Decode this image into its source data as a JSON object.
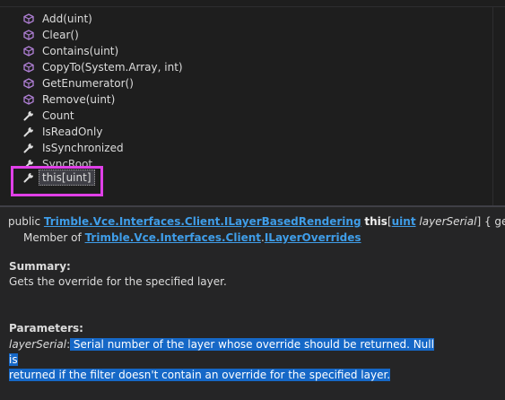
{
  "members": [
    {
      "label": "Add(uint)",
      "icon": "method-cube-icon"
    },
    {
      "label": "Clear()",
      "icon": "method-cube-icon"
    },
    {
      "label": "Contains(uint)",
      "icon": "method-cube-icon"
    },
    {
      "label": "CopyTo(System.Array, int)",
      "icon": "method-cube-icon"
    },
    {
      "label": "GetEnumerator()",
      "icon": "method-cube-icon"
    },
    {
      "label": "Remove(uint)",
      "icon": "method-cube-icon"
    },
    {
      "label": "Count",
      "icon": "property-wrench-icon"
    },
    {
      "label": "IsReadOnly",
      "icon": "property-wrench-icon"
    },
    {
      "label": "IsSynchronized",
      "icon": "property-wrench-icon"
    },
    {
      "label": "SyncRoot",
      "icon": "property-wrench-icon"
    },
    {
      "label": "this[uint]",
      "icon": "property-wrench-icon"
    }
  ],
  "tooltip": {
    "signature": {
      "prefix": "public ",
      "return_type": "Trimble.Vce.Interfaces.Client.ILayerBasedRendering",
      "space": " ",
      "name": "this",
      "open_bracket": "[",
      "param_type": "uint",
      "space2": " ",
      "param_name": "layerSerial",
      "suffix": "] { get; }"
    },
    "member_of": {
      "prefix": "Member of ",
      "namespace": "Trimble.Vce.Interfaces.Client",
      "dot": ".",
      "type": "ILayerOverrides"
    },
    "summary_heading": "Summary:",
    "summary_text": "Gets the override for the specified layer.",
    "parameters_heading": "Parameters:",
    "param_name": "layerSerial",
    "param_colon": ":",
    "param_desc_line1": " Serial number of the layer whose override should be returned. Null is",
    "param_desc_line2": " returned if the filter doesn't contain an override for the specified layer."
  },
  "colors": {
    "background": "#1e1e1e",
    "tooltip_background": "#252526",
    "link": "#3f9de8",
    "method_icon": "#b180d7",
    "highlight_frame": "#e040e8",
    "selection": "#1668c7"
  }
}
